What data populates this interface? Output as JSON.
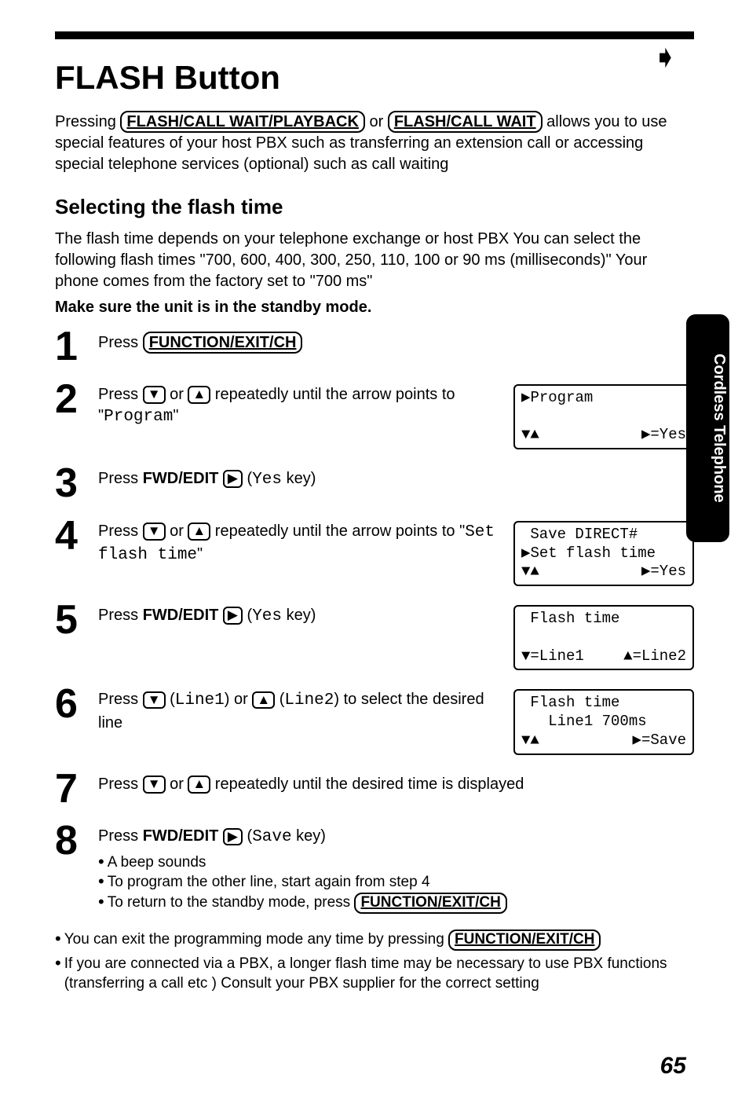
{
  "page_arrow": "➧",
  "title": "FLASH Button",
  "intro": {
    "t1": "Pressing ",
    "key1": "FLASH/CALL WAIT/PLAYBACK",
    "t2": " or ",
    "key2": "FLASH/CALL WAIT",
    "t3": " allows you to use special features of your host PBX such as transferring an extension call or accessing special telephone services (optional) such as call waiting"
  },
  "subhead": "Selecting the flash time",
  "para": "The flash time depends on your telephone exchange or host PBX  You can select the following flash times  \"700, 600, 400, 300, 250, 110, 100 or 90 ms (milliseconds)\"  Your phone comes from the factory set to \"700 ms\"",
  "standby": "Make sure the unit is in the standby mode.",
  "steps": [
    {
      "num": "1",
      "pre": "Press ",
      "key": "FUNCTION/EXIT/CH",
      "post": ""
    },
    {
      "num": "2",
      "text_a": "Press ",
      "k1": "▼",
      "text_b": " or ",
      "k2": "▲",
      "text_c": " repeatedly until the arrow points to \"",
      "mono": "Program",
      "text_d": "\"",
      "display": {
        "line1_left": "▶Program",
        "bot_left": "▼▲",
        "bot_right": "▶=Yes"
      }
    },
    {
      "num": "3",
      "pre": "Press ",
      "fwd": "FWD/EDIT",
      "play": "▶",
      "post": " (",
      "mono": "Yes",
      "post2": " key)"
    },
    {
      "num": "4",
      "text_a": "Press ",
      "k1": "▼",
      "text_b": " or ",
      "k2": "▲",
      "text_c": " repeatedly until the arrow points to \"",
      "mono": "Set flash time",
      "text_d": "\"",
      "display": {
        "line1": " Save DIRECT#",
        "line2": "▶Set flash time",
        "bot_left": "▼▲",
        "bot_right": "▶=Yes"
      }
    },
    {
      "num": "5",
      "pre": "Press ",
      "fwd": "FWD/EDIT",
      "play": "▶",
      "post": " (",
      "mono": "Yes",
      "post2": " key)",
      "display": {
        "line1": " Flash time",
        "line2": " ",
        "bot_left": "▼=Line1",
        "bot_right": "▲=Line2"
      }
    },
    {
      "num": "6",
      "text_a": "Press ",
      "k1": "▼",
      "text_b": " (",
      "mono1": "Line1",
      "text_c": ") or ",
      "k2": "▲",
      "text_d": " (",
      "mono2": "Line2",
      "text_e": ") to select the desired line",
      "display": {
        "line1": " Flash time",
        "line2": "   Line1 700ms",
        "bot_left": "▼▲",
        "bot_right": "▶=Save"
      }
    },
    {
      "num": "7",
      "text_a": "Press ",
      "k1": "▼",
      "text_b": " or ",
      "k2": "▲",
      "text_c": " repeatedly until the desired time is displayed"
    },
    {
      "num": "8",
      "pre": "Press ",
      "fwd": "FWD/EDIT",
      "play": "▶",
      "post": " (",
      "mono": "Save",
      "post2": " key)",
      "bullets": [
        {
          "text": "A beep sounds"
        },
        {
          "pre": "To program the other line, start again from step 4"
        },
        {
          "pre": "To return to the standby mode, press ",
          "key": "FUNCTION/EXIT/CH"
        }
      ]
    }
  ],
  "footnotes": [
    {
      "pre": "You can exit the programming mode any time by pressing ",
      "key": "FUNCTION/EXIT/CH"
    },
    {
      "text": "If you are connected via a PBX, a longer flash time may be necessary to use PBX functions (transferring a call etc )  Consult your PBX supplier for the correct setting"
    }
  ],
  "page_number": "65",
  "side_tab": "Cordless Telephone"
}
